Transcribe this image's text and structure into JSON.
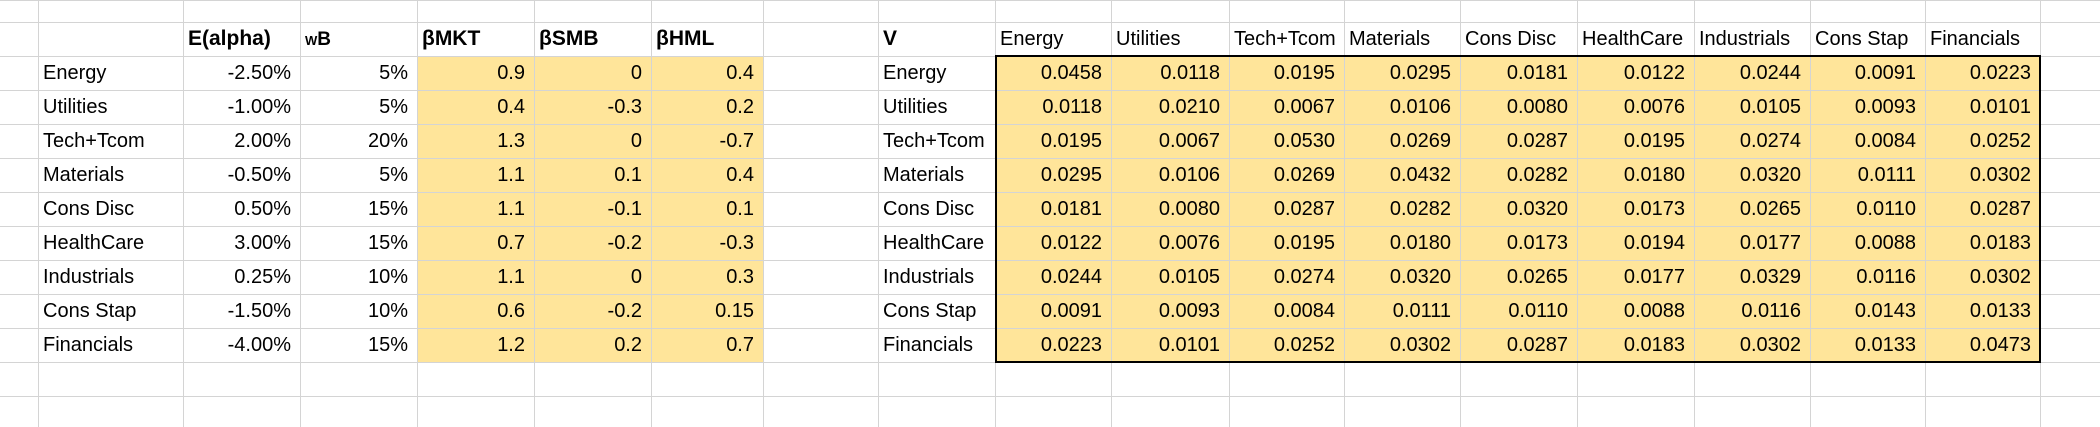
{
  "headers": {
    "alpha": "E(alpha)",
    "wb": "wB",
    "beta_mkt": "βMKT",
    "beta_smb": "βSMB",
    "beta_hml": "βHML",
    "cov_label": "V"
  },
  "rows": [
    {
      "sector": "Energy",
      "alpha": "-2.50%",
      "wb": "5%",
      "bmkt": "0.9",
      "bsmb": "0",
      "bhml": "0.4"
    },
    {
      "sector": "Utilities",
      "alpha": "-1.00%",
      "wb": "5%",
      "bmkt": "0.4",
      "bsmb": "-0.3",
      "bhml": "0.2"
    },
    {
      "sector": "Tech+Tcom",
      "alpha": "2.00%",
      "wb": "20%",
      "bmkt": "1.3",
      "bsmb": "0",
      "bhml": "-0.7"
    },
    {
      "sector": "Materials",
      "alpha": "-0.50%",
      "wb": "5%",
      "bmkt": "1.1",
      "bsmb": "0.1",
      "bhml": "0.4"
    },
    {
      "sector": "Cons Disc",
      "alpha": "0.50%",
      "wb": "15%",
      "bmkt": "1.1",
      "bsmb": "-0.1",
      "bhml": "0.1"
    },
    {
      "sector": "HealthCare",
      "alpha": "3.00%",
      "wb": "15%",
      "bmkt": "0.7",
      "bsmb": "-0.2",
      "bhml": "-0.3"
    },
    {
      "sector": "Industrials",
      "alpha": "0.25%",
      "wb": "10%",
      "bmkt": "1.1",
      "bsmb": "0",
      "bhml": "0.3"
    },
    {
      "sector": "Cons Stap",
      "alpha": "-1.50%",
      "wb": "10%",
      "bmkt": "0.6",
      "bsmb": "-0.2",
      "bhml": "0.15"
    },
    {
      "sector": "Financials",
      "alpha": "-4.00%",
      "wb": "15%",
      "bmkt": "1.2",
      "bsmb": "0.2",
      "bhml": "0.7"
    }
  ],
  "cov_headers": [
    "Energy",
    "Utilities",
    "Tech+Tcom",
    "Materials",
    "Cons Disc",
    "HealthCare",
    "Industrials",
    "Cons Stap",
    "Financials"
  ],
  "cov_rows": [
    {
      "label": "Energy",
      "values": [
        "0.0458",
        "0.0118",
        "0.0195",
        "0.0295",
        "0.0181",
        "0.0122",
        "0.0244",
        "0.0091",
        "0.0223"
      ]
    },
    {
      "label": "Utilities",
      "values": [
        "0.0118",
        "0.0210",
        "0.0067",
        "0.0106",
        "0.0080",
        "0.0076",
        "0.0105",
        "0.0093",
        "0.0101"
      ]
    },
    {
      "label": "Tech+Tcom",
      "values": [
        "0.0195",
        "0.0067",
        "0.0530",
        "0.0269",
        "0.0287",
        "0.0195",
        "0.0274",
        "0.0084",
        "0.0252"
      ]
    },
    {
      "label": "Materials",
      "values": [
        "0.0295",
        "0.0106",
        "0.0269",
        "0.0432",
        "0.0282",
        "0.0180",
        "0.0320",
        "0.0111",
        "0.0302"
      ]
    },
    {
      "label": "Cons Disc",
      "values": [
        "0.0181",
        "0.0080",
        "0.0287",
        "0.0282",
        "0.0320",
        "0.0173",
        "0.0265",
        "0.0110",
        "0.0287"
      ]
    },
    {
      "label": "HealthCare",
      "values": [
        "0.0122",
        "0.0076",
        "0.0195",
        "0.0180",
        "0.0173",
        "0.0194",
        "0.0177",
        "0.0088",
        "0.0183"
      ]
    },
    {
      "label": "Industrials",
      "values": [
        "0.0244",
        "0.0105",
        "0.0274",
        "0.0320",
        "0.0265",
        "0.0177",
        "0.0329",
        "0.0116",
        "0.0302"
      ]
    },
    {
      "label": "Cons Stap",
      "values": [
        "0.0091",
        "0.0093",
        "0.0084",
        "0.0111",
        "0.0110",
        "0.0088",
        "0.0116",
        "0.0143",
        "0.0133"
      ]
    },
    {
      "label": "Financials",
      "values": [
        "0.0223",
        "0.0101",
        "0.0252",
        "0.0302",
        "0.0287",
        "0.0183",
        "0.0302",
        "0.0133",
        "0.0473"
      ]
    }
  ],
  "colors": {
    "highlight": "#ffe59a",
    "gridline": "#d4d4d4",
    "border": "#000000"
  }
}
